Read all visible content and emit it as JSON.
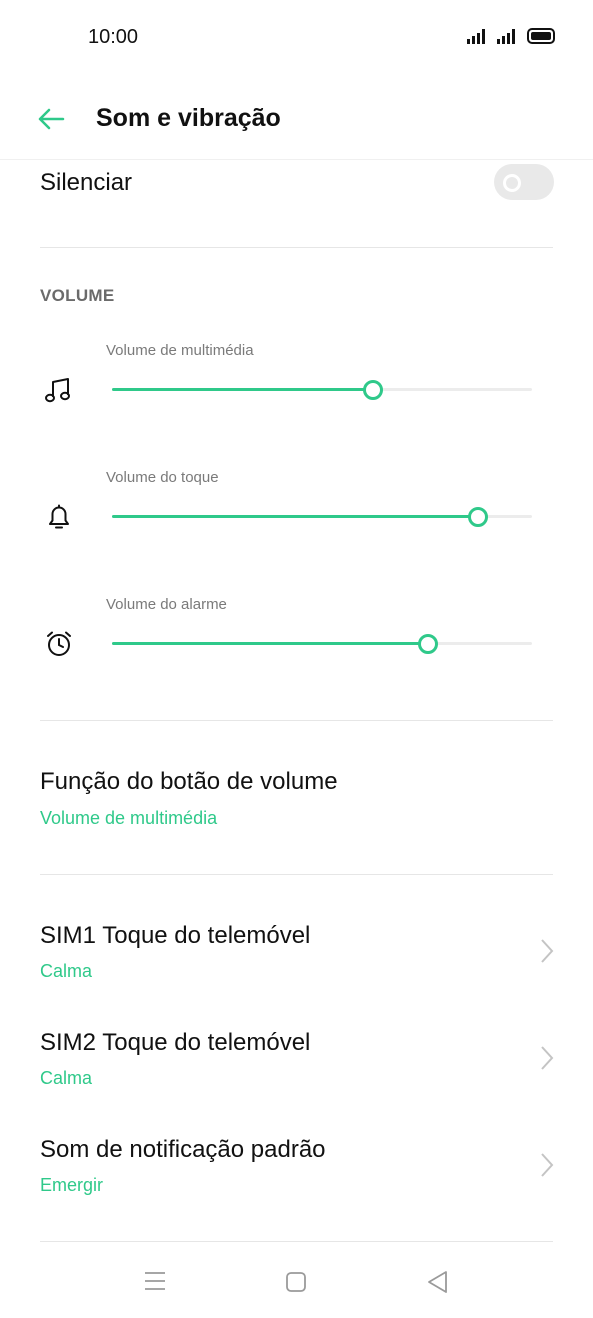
{
  "status_bar": {
    "time": "10:00"
  },
  "header": {
    "title": "Som e vibração"
  },
  "mute": {
    "label": "Silenciar",
    "enabled": false
  },
  "volume_section": {
    "label": "VOLUME",
    "sliders": [
      {
        "label": "Volume de multimédia",
        "icon": "music-note-icon",
        "level": 0.62
      },
      {
        "label": "Volume do toque",
        "icon": "bell-icon",
        "level": 0.87
      },
      {
        "label": "Volume do alarme",
        "icon": "alarm-clock-icon",
        "level": 0.75
      }
    ]
  },
  "volume_button": {
    "title": "Função do botão de volume",
    "value": "Volume de multimédia"
  },
  "ringtones": [
    {
      "title": "SIM1 Toque do telemóvel",
      "value": "Calma"
    },
    {
      "title": "SIM2 Toque do telemóvel",
      "value": "Calma"
    },
    {
      "title": "Som de notificação padrão",
      "value": "Emergir"
    }
  ],
  "colors": {
    "accent": "#2fc98a",
    "track": "#ececec",
    "text": "#111111"
  }
}
